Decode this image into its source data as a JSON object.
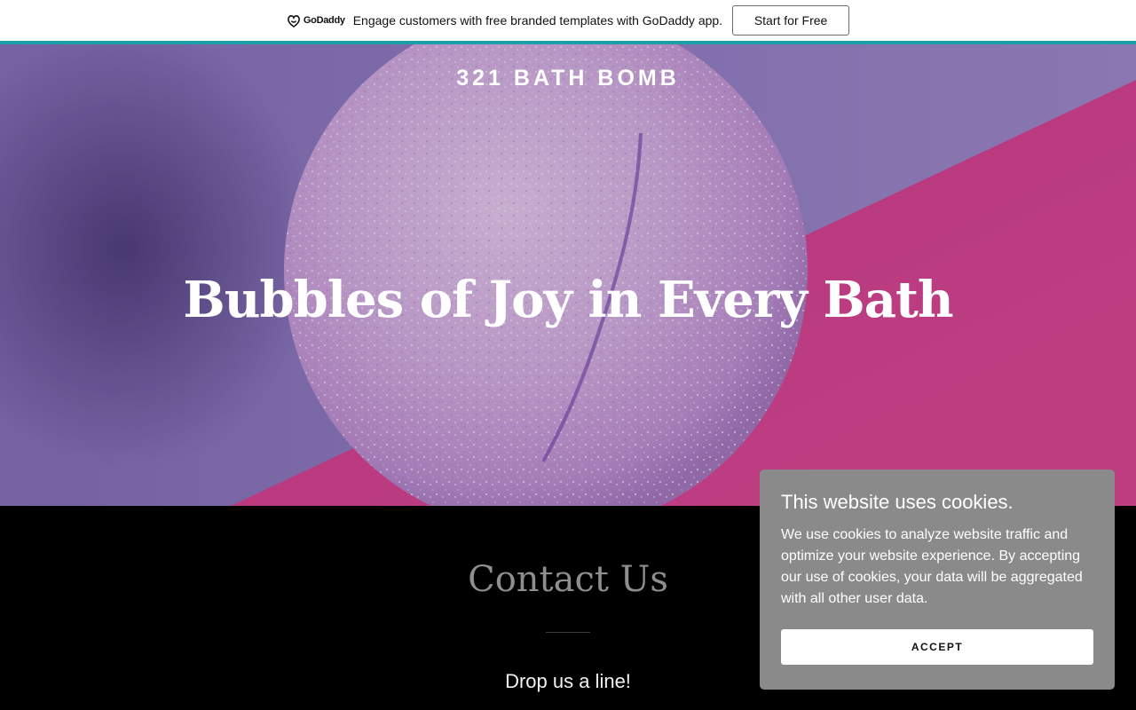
{
  "promo": {
    "logo_text": "GoDaddy",
    "message": "Engage customers with free branded templates with GoDaddy app.",
    "cta_label": "Start for Free",
    "accent_color": "#1ba0a5"
  },
  "hero": {
    "site_title": "321 BATH BOMB",
    "headline": "Bubbles of Joy in Every Bath",
    "image_subject": "bath-bomb-photo",
    "colors": {
      "background_purple": "#8a74b4",
      "background_pink": "#c7367f",
      "bomb_lilac": "#c9a8d4"
    }
  },
  "contact": {
    "title": "Contact Us",
    "subtitle": "Drop us a line!"
  },
  "cookie": {
    "title": "This website uses cookies.",
    "body": "We use cookies to analyze website traffic and optimize your website experience. By accepting our use of cookies, your data will be aggregated with all other user data.",
    "accept_label": "ACCEPT",
    "background": "#8a8a8a"
  }
}
